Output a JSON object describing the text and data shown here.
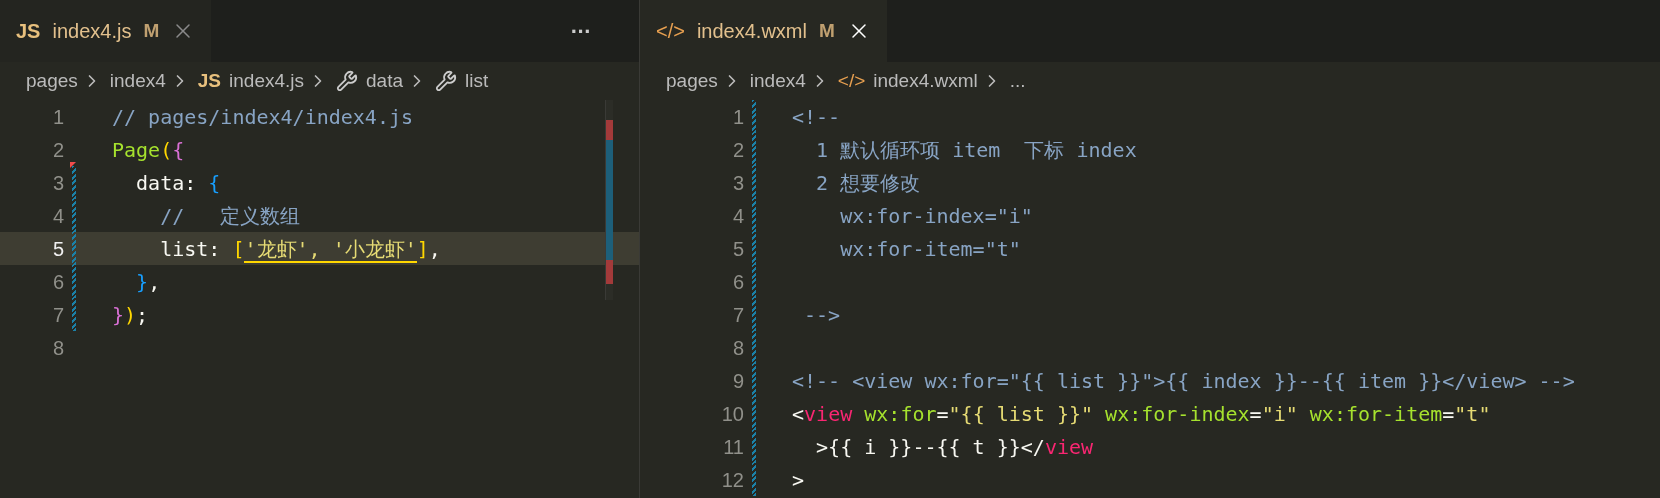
{
  "panes": [
    {
      "tab": {
        "icon_text": "JS",
        "kind": "js",
        "label": "index4.js",
        "badge": "M",
        "selected": false
      },
      "more": "···",
      "breadcrumbs": [
        {
          "kind": "folder",
          "text": "pages"
        },
        {
          "kind": "folder",
          "text": "index4"
        },
        {
          "kind": "js",
          "icon_text": "JS",
          "text": "index4.js"
        },
        {
          "kind": "symbol",
          "text": "data"
        },
        {
          "kind": "symbol",
          "text": "list"
        }
      ],
      "lines": [
        {
          "number": "1",
          "active": false,
          "modified": false,
          "deleted_above": false,
          "tokens": [
            {
              "kind": "comment",
              "text": "// pages/index4/index4.js"
            }
          ]
        },
        {
          "number": "2",
          "active": false,
          "modified": false,
          "deleted_above": false,
          "tokens": [
            {
              "kind": "func",
              "text": "Page"
            },
            {
              "kind": "gold",
              "text": "("
            },
            {
              "kind": "magenta",
              "text": "{"
            }
          ]
        },
        {
          "number": "3",
          "active": false,
          "modified": true,
          "deleted_above": true,
          "tokens": [
            {
              "kind": "plain",
              "text": "  data: "
            },
            {
              "kind": "blue",
              "text": "{"
            }
          ]
        },
        {
          "number": "4",
          "active": false,
          "modified": true,
          "deleted_above": false,
          "tokens": [
            {
              "kind": "comment",
              "text": "    //   定义数组"
            }
          ]
        },
        {
          "number": "5",
          "active": true,
          "modified": true,
          "deleted_above": false,
          "tokens": [
            {
              "kind": "plain",
              "text": "    list: "
            },
            {
              "kind": "gold",
              "text": "["
            },
            {
              "kind": "string",
              "text": "'龙虾', '小龙虾'",
              "underline": true
            },
            {
              "kind": "gold",
              "text": "]"
            },
            {
              "kind": "plain",
              "text": ","
            }
          ]
        },
        {
          "number": "6",
          "active": false,
          "modified": true,
          "deleted_above": false,
          "tokens": [
            {
              "kind": "blue",
              "text": "  }"
            },
            {
              "kind": "plain",
              "text": ","
            }
          ]
        },
        {
          "number": "7",
          "active": false,
          "modified": true,
          "deleted_above": false,
          "tokens": [
            {
              "kind": "magenta",
              "text": "}"
            },
            {
              "kind": "gold",
              "text": ")"
            },
            {
              "kind": "plain",
              "text": ";"
            }
          ]
        },
        {
          "number": "8",
          "active": false,
          "modified": false,
          "deleted_above": false
        }
      ]
    },
    {
      "tab": {
        "icon_text": "</>",
        "kind": "xml",
        "label": "index4.wxml",
        "badge": "M",
        "selected": true
      },
      "breadcrumbs": [
        {
          "kind": "folder",
          "text": "pages"
        },
        {
          "kind": "folder",
          "text": "index4"
        },
        {
          "kind": "xml",
          "icon_text": "</>",
          "text": "index4.wxml"
        },
        {
          "kind": "ellipsis",
          "text": "..."
        }
      ],
      "lines": [
        {
          "number": "1",
          "active": false,
          "modified": true,
          "deleted_above": false,
          "tokens": [
            {
              "kind": "comment",
              "text": "<!--"
            }
          ]
        },
        {
          "number": "2",
          "active": false,
          "modified": true,
          "deleted_above": false,
          "tokens": [
            {
              "kind": "comment",
              "text": "  1 默认循环项 item  下标 index"
            }
          ]
        },
        {
          "number": "3",
          "active": false,
          "modified": true,
          "deleted_above": false,
          "tokens": [
            {
              "kind": "comment",
              "text": "  2 想要修改"
            }
          ]
        },
        {
          "number": "4",
          "active": false,
          "modified": true,
          "deleted_above": false,
          "tokens": [
            {
              "kind": "comment",
              "text": "    wx:for-index=\"i\""
            }
          ]
        },
        {
          "number": "5",
          "active": false,
          "modified": true,
          "deleted_above": false,
          "tokens": [
            {
              "kind": "comment",
              "text": "    wx:for-item=\"t\""
            }
          ]
        },
        {
          "number": "6",
          "active": false,
          "modified": true,
          "deleted_above": false
        },
        {
          "number": "7",
          "active": false,
          "modified": true,
          "deleted_above": false,
          "tokens": [
            {
              "kind": "comment",
              "text": " -->"
            }
          ]
        },
        {
          "number": "8",
          "active": false,
          "modified": true,
          "deleted_above": false
        },
        {
          "number": "9",
          "active": false,
          "modified": true,
          "deleted_above": false,
          "tokens": [
            {
              "kind": "comment",
              "text": "<!-- <view wx:for=\"{{ list }}\">{{ index }}--{{ item }}</view> -->"
            }
          ]
        },
        {
          "number": "10",
          "active": false,
          "modified": true,
          "deleted_above": false,
          "tokens": [
            {
              "kind": "plain",
              "text": "<"
            },
            {
              "kind": "tag",
              "text": "view"
            },
            {
              "kind": "attr",
              "text": " wx:for"
            },
            {
              "kind": "plain",
              "text": "="
            },
            {
              "kind": "string",
              "text": "\"{{ list }}\""
            },
            {
              "kind": "attr",
              "text": " wx:for-index"
            },
            {
              "kind": "plain",
              "text": "="
            },
            {
              "kind": "string",
              "text": "\"i\""
            },
            {
              "kind": "attr",
              "text": " wx:for-item"
            },
            {
              "kind": "plain",
              "text": "="
            },
            {
              "kind": "string",
              "text": "\"t\""
            }
          ]
        },
        {
          "number": "11",
          "active": false,
          "modified": true,
          "deleted_above": false,
          "tokens": [
            {
              "kind": "plain",
              "text": "  >{{ i }}--{{ t }}</"
            },
            {
              "kind": "tag",
              "text": "view"
            }
          ]
        },
        {
          "number": "12",
          "active": false,
          "modified": true,
          "deleted_above": false,
          "tokens": [
            {
              "kind": "plain",
              "text": ">"
            }
          ]
        }
      ]
    }
  ]
}
